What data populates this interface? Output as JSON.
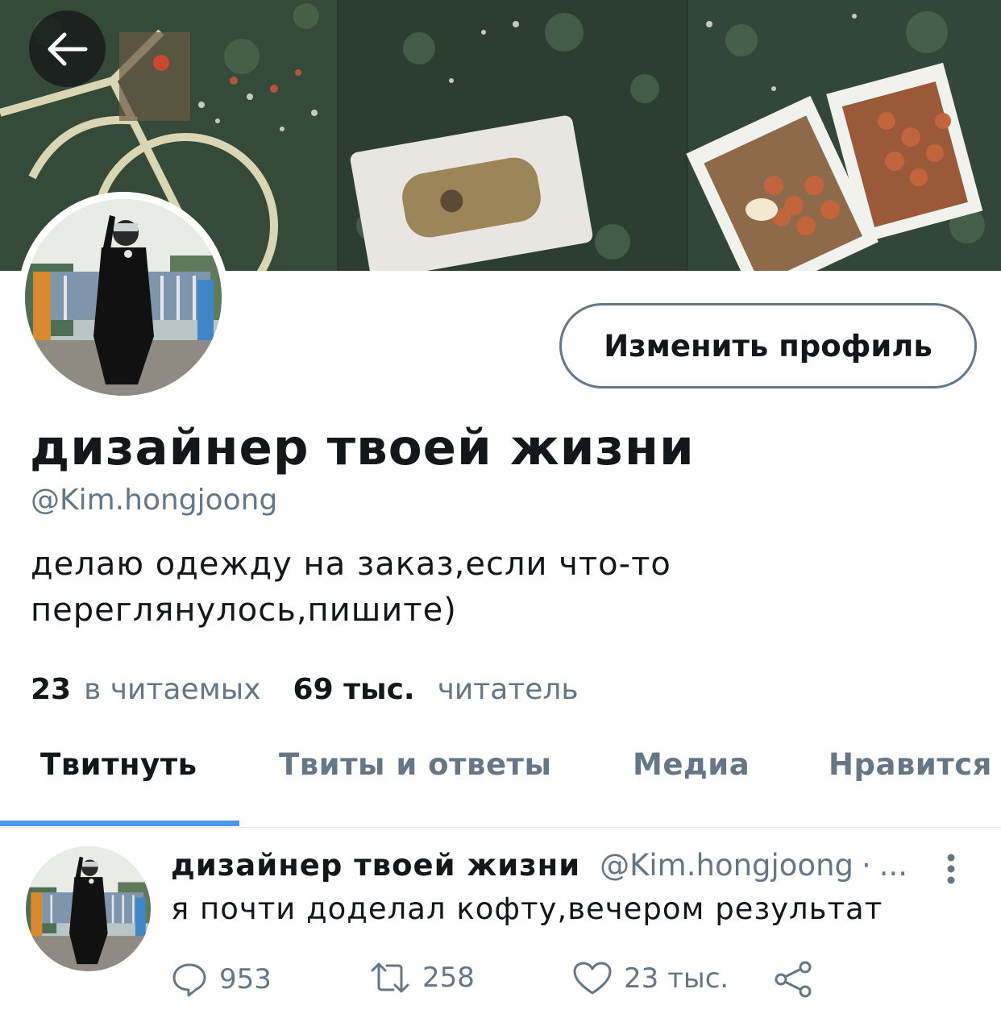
{
  "header": {
    "back_icon": "arrow-left-icon",
    "edit_profile_label": "Изменить профиль"
  },
  "profile": {
    "display_name": "дизайнер твоей жизни",
    "handle": "@Kim.hongjoong",
    "bio": "делаю одежду на заказ,если что-то переглянулось,пишите)",
    "following_count": "23",
    "following_label": "в читаемых",
    "followers_count": "69 тыс.",
    "followers_label": "читатель"
  },
  "tabs": [
    {
      "label": "Твитнуть",
      "active": true
    },
    {
      "label": "Твиты и ответы",
      "active": false
    },
    {
      "label": "Медиа",
      "active": false
    },
    {
      "label": "Нравится",
      "active": false
    }
  ],
  "tweet": {
    "author_name": "дизайнер твоей жизни",
    "author_handle": "@Kim.hongjoong",
    "separator": "·",
    "time": "...",
    "text": "я почти доделал кофту,вечером результат",
    "replies": "953",
    "retweets": "258",
    "likes": "23 тыс."
  },
  "colors": {
    "accent": "#4a99e9",
    "secondary_text": "#657786",
    "primary_text": "#14171a"
  }
}
